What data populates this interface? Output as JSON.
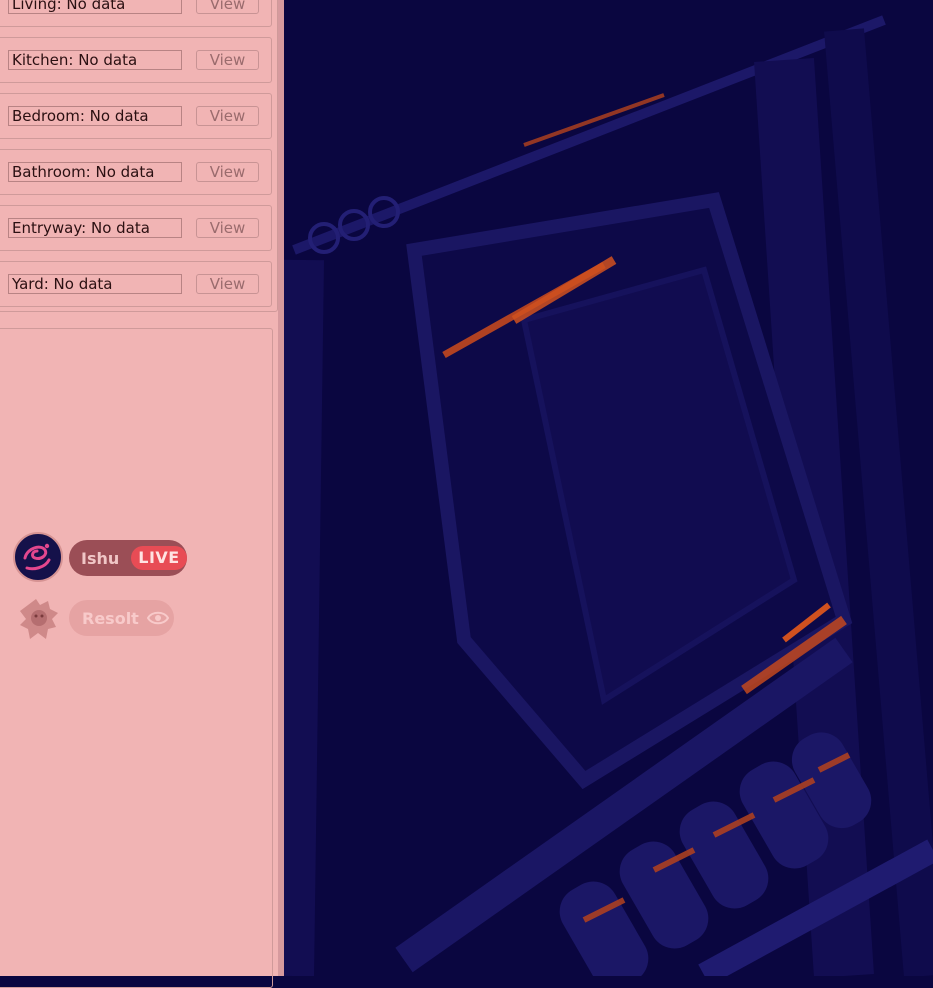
{
  "rooms": [
    {
      "label": "Living: No data",
      "button": "View"
    },
    {
      "label": "Kitchen: No data",
      "button": "View"
    },
    {
      "label": "Bedroom: No data",
      "button": "View"
    },
    {
      "label": "Bathroom: No data",
      "button": "View"
    },
    {
      "label": "Entryway: No data",
      "button": "View"
    },
    {
      "label": "Yard: No data",
      "button": "View"
    }
  ],
  "users": [
    {
      "name": "Ishu",
      "badge": "LIVE",
      "icon": "live-badge"
    },
    {
      "name": "Resolt",
      "icon": "eye-icon"
    }
  ],
  "colors": {
    "panel_bg": "#f1b4b4",
    "scene_bg": "#0a0640",
    "live_red": "#e84c55",
    "rust": "#c2481e"
  }
}
